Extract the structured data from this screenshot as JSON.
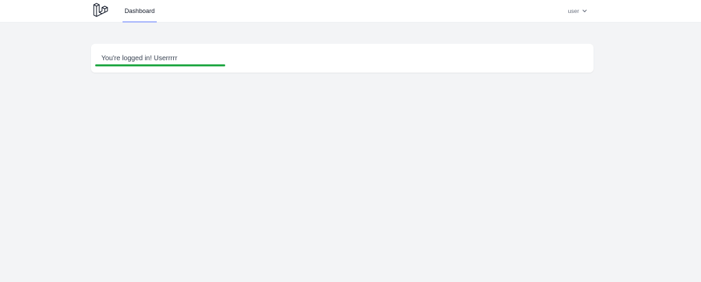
{
  "nav": {
    "logo_icon": "laravel-logo-icon",
    "links": [
      {
        "label": "Dashboard",
        "active": true
      }
    ],
    "user": {
      "name": "user",
      "dropdown_icon": "chevron-down-icon"
    }
  },
  "main": {
    "card": {
      "message": "You're logged in! Userrrrr",
      "underline_color": "#22a845"
    }
  },
  "colors": {
    "page_background": "#f3f4f6",
    "active_nav_underline": "#a5b4fc"
  }
}
